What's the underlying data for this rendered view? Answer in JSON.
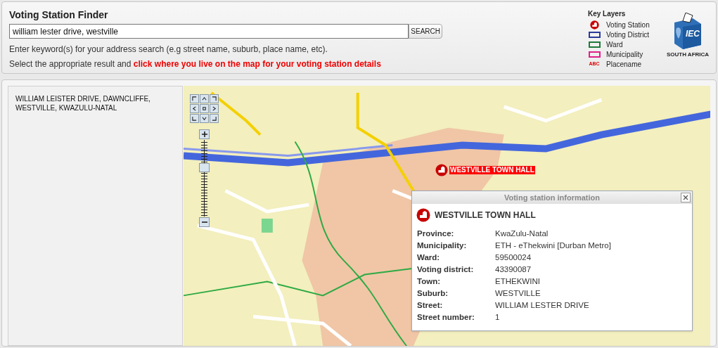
{
  "header": {
    "title": "Voting Station Finder",
    "search": {
      "value": "william lester drive, westville",
      "button": "SEARCH"
    },
    "hint": "Enter keyword(s) for your address search (e.g street name, suburb, place name, etc).",
    "instruction": "Select the appropriate result and **click where you live on the map for your voting station details**"
  },
  "key_layers": {
    "title": "Key Layers",
    "items": [
      {
        "kind": "station",
        "label": "Voting Station"
      },
      {
        "kind": "box",
        "color": "#2b3a9a",
        "label": "Voting District"
      },
      {
        "kind": "box",
        "color": "#1e7a3a",
        "label": "Ward"
      },
      {
        "kind": "box",
        "color": "#e0208a",
        "label": "Municipality"
      },
      {
        "kind": "text",
        "symbol": "ABC",
        "label": "Placename"
      }
    ]
  },
  "logo": {
    "text": "IEC",
    "caption": "SOUTH AFRICA"
  },
  "results": [
    {
      "text": "WILLIAM LEISTER DRIVE, DAWNCLIFFE, WESTVILLE, KWAZULU-NATAL",
      "selected": false
    }
  ],
  "map": {
    "zoom": {
      "level": 0.66
    },
    "marker": {
      "label": "WESTVILLE TOWN HALL"
    },
    "popup": {
      "title": "Voting station information",
      "station": "WESTVILLE TOWN HALL",
      "fields": [
        {
          "label": "Province:",
          "value": "KwaZulu-Natal"
        },
        {
          "label": "Municipality:",
          "value": "ETH - eThekwini [Durban Metro]"
        },
        {
          "label": "Ward:",
          "value": "59500024"
        },
        {
          "label": "Voting district:",
          "value": "43390087"
        },
        {
          "label": "Town:",
          "value": "ETHEKWINI"
        },
        {
          "label": "Suburb:",
          "value": "WESTVILLE"
        },
        {
          "label": "Street:",
          "value": "WILLIAM LESTER DRIVE"
        },
        {
          "label": "Street number:",
          "value": "1"
        }
      ]
    }
  }
}
